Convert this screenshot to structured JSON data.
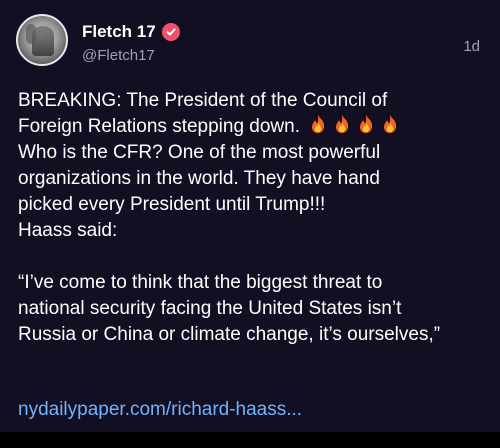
{
  "post": {
    "author": {
      "display_name": "Fletch 17",
      "handle": "@Fletch17",
      "verified_badge_icon": "verified-check-icon",
      "badge_color": "#f0506e"
    },
    "timestamp": "1d",
    "body": {
      "line1": "BREAKING: The President of the Council of",
      "line2": "Foreign Relations stepping down.",
      "line2_emoji": [
        "fire-icon",
        "fire-icon",
        "fire-icon",
        "fire-icon"
      ],
      "line3": "Who is the CFR? One of the most powerful",
      "line4": "organizations in the world. They have hand",
      "line5": "picked every President until Trump!!!",
      "line6": "Haass said:",
      "line7": "“I’ve come to think that the biggest threat to",
      "line8": "national security facing the United States isn’t",
      "line9": "Russia or China or climate change, it’s ourselves,”"
    },
    "link_text": "nydailypaper.com/richard-haass..."
  },
  "colors": {
    "background": "#120f22",
    "text": "#ffffff",
    "muted_text": "#a3a0b5",
    "link": "#6fb4ff"
  }
}
